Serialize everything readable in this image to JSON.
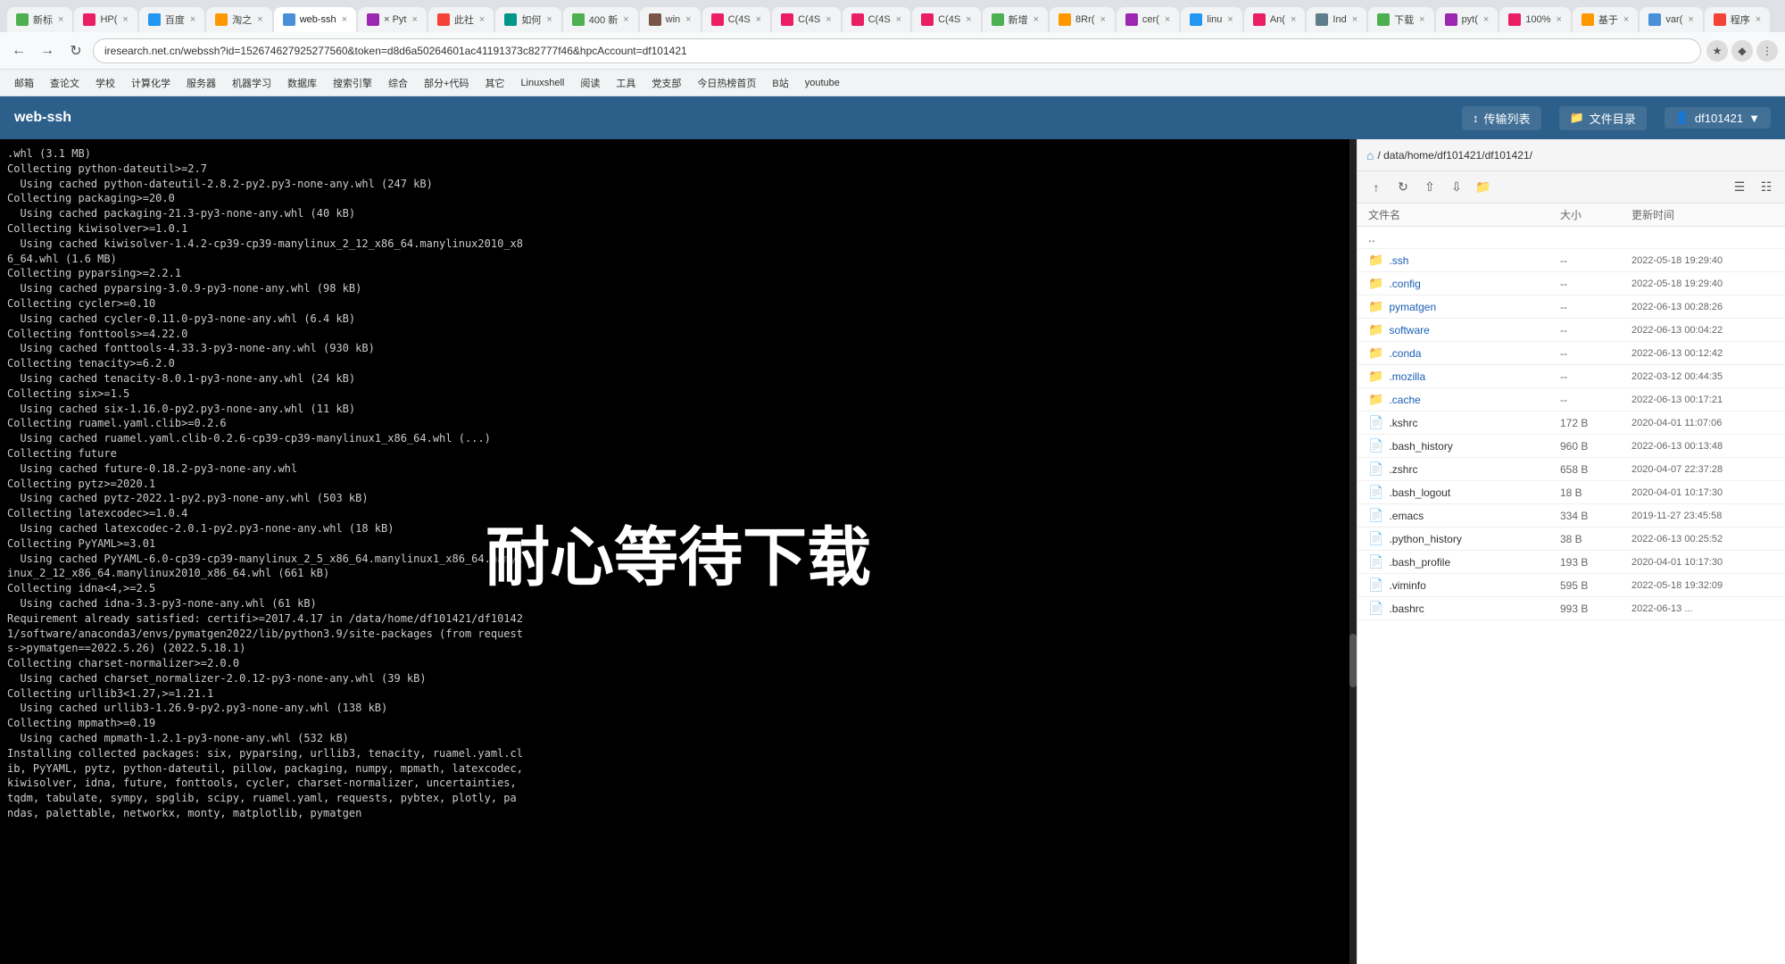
{
  "browser": {
    "tabs": [
      {
        "id": 1,
        "label": "新标",
        "active": false,
        "color": "#4caf50"
      },
      {
        "id": 2,
        "label": "HP(",
        "active": false,
        "color": "#e91e63"
      },
      {
        "id": 3,
        "label": "百度",
        "active": false,
        "color": "#2196f3"
      },
      {
        "id": 4,
        "label": "淘之",
        "active": false,
        "color": "#ff9800"
      },
      {
        "id": 5,
        "label": "web-ssh",
        "active": true,
        "color": "#4a90d9"
      },
      {
        "id": 6,
        "label": "× Pyt",
        "active": false,
        "color": "#9c27b0"
      },
      {
        "id": 7,
        "label": "此社",
        "active": false,
        "color": "#f44336"
      },
      {
        "id": 8,
        "label": "如何",
        "active": false,
        "color": "#009688"
      },
      {
        "id": 9,
        "label": "400 新",
        "active": false,
        "color": "#4caf50"
      },
      {
        "id": 10,
        "label": "win",
        "active": false,
        "color": "#795548"
      },
      {
        "id": 11,
        "label": "C(4S",
        "active": false,
        "color": "#e91e63"
      },
      {
        "id": 12,
        "label": "C(4S",
        "active": false,
        "color": "#e91e63"
      },
      {
        "id": 13,
        "label": "C(4S",
        "active": false,
        "color": "#e91e63"
      },
      {
        "id": 14,
        "label": "C(4S",
        "active": false,
        "color": "#e91e63"
      },
      {
        "id": 15,
        "label": "新增",
        "active": false,
        "color": "#4caf50"
      },
      {
        "id": 16,
        "label": "8Rr(",
        "active": false,
        "color": "#ff9800"
      },
      {
        "id": 17,
        "label": "cer(",
        "active": false,
        "color": "#9c27b0"
      },
      {
        "id": 18,
        "label": "linu",
        "active": false,
        "color": "#2196f3"
      },
      {
        "id": 19,
        "label": "An(",
        "active": false,
        "color": "#e91e63"
      },
      {
        "id": 20,
        "label": "Ind",
        "active": false,
        "color": "#607d8b"
      },
      {
        "id": 21,
        "label": "下载",
        "active": false,
        "color": "#4caf50"
      },
      {
        "id": 22,
        "label": "pyt(",
        "active": false,
        "color": "#9c27b0"
      },
      {
        "id": 23,
        "label": "100%",
        "active": false,
        "color": "#e91e63"
      },
      {
        "id": 24,
        "label": "基于",
        "active": false,
        "color": "#ff9800"
      },
      {
        "id": 25,
        "label": "var(",
        "active": false,
        "color": "#4a90d9"
      },
      {
        "id": 26,
        "label": "程序",
        "active": false,
        "color": "#f44336"
      }
    ],
    "url": "iresearch.net.cn/webssh?id=152674627925277560&token=d8d6a50264601ac41191373c82777f46&hpcAccount=df101421",
    "bookmarks": [
      "邮箱",
      "查论文",
      "学校",
      "计算化学",
      "服务器",
      "机器学习",
      "数据库",
      "搜索引擎",
      "综合",
      "部分+代码",
      "其它",
      "Linuxshell",
      "阅读",
      "工具",
      "党支部",
      "今日热榜首页",
      "B站",
      "youtube"
    ]
  },
  "app": {
    "title": "web-ssh",
    "header_btns": [
      "传输列表",
      "文件目录",
      "df101421"
    ]
  },
  "terminal": {
    "overlay": "耐心等待下载",
    "content": ".whl (3.1 MB)\nCollecting python-dateutil>=2.7\n  Using cached python-dateutil-2.8.2-py2.py3-none-any.whl (247 kB)\nCollecting packaging>=20.0\n  Using cached packaging-21.3-py3-none-any.whl (40 kB)\nCollecting kiwisolver>=1.0.1\n  Using cached kiwisolver-1.4.2-cp39-cp39-manylinux_2_12_x86_64.manylinux2010_x8\n6_64.whl (1.6 MB)\nCollecting pyparsing>=2.2.1\n  Using cached pyparsing-3.0.9-py3-none-any.whl (98 kB)\nCollecting cycler>=0.10\n  Using cached cycler-0.11.0-py3-none-any.whl (6.4 kB)\nCollecting fonttools>=4.22.0\n  Using cached fonttools-4.33.3-py3-none-any.whl (930 kB)\nCollecting tenacity>=6.2.0\n  Using cached tenacity-8.0.1-py3-none-any.whl (24 kB)\nCollecting six>=1.5\n  Using cached six-1.16.0-py2.py3-none-any.whl (11 kB)\nCollecting ruamel.yaml.clib>=0.2.6\n  Using cached ruamel.yaml.clib-0.2.6-cp39-cp39-manylinux1_x86_64.whl (...)\nCollecting future\n  Using cached future-0.18.2-py3-none-any.whl\nCollecting pytz>=2020.1\n  Using cached pytz-2022.1-py2.py3-none-any.whl (503 kB)\nCollecting latexcodec>=1.0.4\n  Using cached latexcodec-2.0.1-py2.py3-none-any.whl (18 kB)\nCollecting PyYAML>=3.01\n  Using cached PyYAML-6.0-cp39-cp39-manylinux_2_5_x86_64.manylinux1_x86_64.manyl\ninux_2_12_x86_64.manylinux2010_x86_64.whl (661 kB)\nCollecting idna<4,>=2.5\n  Using cached idna-3.3-py3-none-any.whl (61 kB)\nRequirement already satisfied: certifi>=2017.4.17 in /data/home/df101421/df10142\n1/software/anaconda3/envs/pymatgen2022/lib/python3.9/site-packages (from request\ns->pymatgen==2022.5.26) (2022.5.18.1)\nCollecting charset-normalizer>=2.0.0\n  Using cached charset_normalizer-2.0.12-py3-none-any.whl (39 kB)\nCollecting urllib3<1.27,>=1.21.1\n  Using cached urllib3-1.26.9-py2.py3-none-any.whl (138 kB)\nCollecting mpmath>=0.19\n  Using cached mpmath-1.2.1-py3-none-any.whl (532 kB)\nInstalling collected packages: six, pyparsing, urllib3, tenacity, ruamel.yaml.cl\nib, PyYAML, pytz, python-dateutil, pillow, packaging, numpy, mpmath, latexcodec,\nkiwisolver, idna, future, fonttools, cycler, charset-normalizer, uncertainties,\ntqdm, tabulate, sympy, spglib, scipy, ruamel.yaml, requests, pybtex, plotly, pa\nndas, palettable, networkx, monty, matplotlib, pymatgen"
  },
  "filemanager": {
    "breadcrumb": "/ data/home/df101421/df101421/",
    "table_headers": [
      "文件名",
      "大小",
      "更新时间"
    ],
    "files": [
      {
        "name": ".ssh",
        "type": "folder",
        "size": "--",
        "date": "2022-05-18 19:29:40"
      },
      {
        "name": ".config",
        "type": "folder",
        "size": "--",
        "date": "2022-05-18 19:29:40"
      },
      {
        "name": "pymatgen",
        "type": "folder",
        "size": "--",
        "date": "2022-06-13 00:28:26"
      },
      {
        "name": "software",
        "type": "folder",
        "size": "--",
        "date": "2022-06-13 00:04:22"
      },
      {
        "name": ".conda",
        "type": "folder",
        "size": "--",
        "date": "2022-06-13 00:12:42"
      },
      {
        "name": ".mozilla",
        "type": "folder",
        "size": "--",
        "date": "2022-03-12 00:44:35"
      },
      {
        "name": ".cache",
        "type": "folder",
        "size": "--",
        "date": "2022-06-13 00:17:21"
      },
      {
        "name": ".kshrc",
        "type": "file",
        "size": "172 B",
        "date": "2020-04-01 11:07:06"
      },
      {
        "name": ".bash_history",
        "type": "file",
        "size": "960 B",
        "date": "2022-06-13 00:13:48"
      },
      {
        "name": ".zshrc",
        "type": "file",
        "size": "658 B",
        "date": "2020-04-07 22:37:28"
      },
      {
        "name": ".bash_logout",
        "type": "file",
        "size": "18 B",
        "date": "2020-04-01 10:17:30"
      },
      {
        "name": ".emacs",
        "type": "file",
        "size": "334 B",
        "date": "2019-11-27 23:45:58"
      },
      {
        "name": ".python_history",
        "type": "file",
        "size": "38 B",
        "date": "2022-06-13 00:25:52"
      },
      {
        "name": ".bash_profile",
        "type": "file",
        "size": "193 B",
        "date": "2020-04-01 10:17:30"
      },
      {
        "name": ".viminfo",
        "type": "file",
        "size": "595 B",
        "date": "2022-05-18 19:32:09"
      },
      {
        "name": ".bashrc",
        "type": "file",
        "size": "993 B",
        "date": "2022-06-13 ..."
      }
    ]
  }
}
